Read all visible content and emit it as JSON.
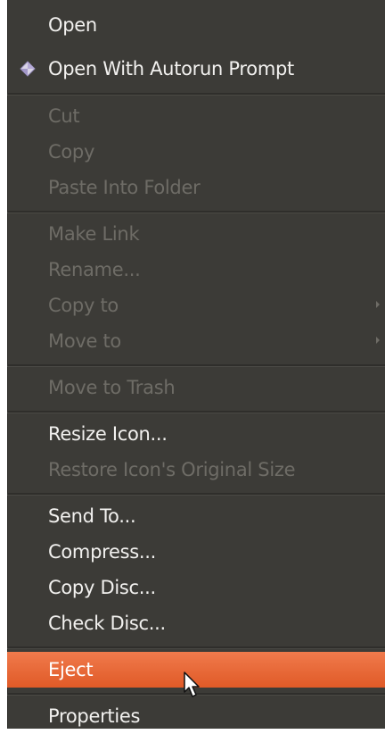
{
  "menu": {
    "items": [
      {
        "label": "Open",
        "enabled": true
      },
      {
        "label": "Open With Autorun Prompt",
        "enabled": true,
        "icon": "autorun-diamond-icon"
      },
      {
        "label": "Cut",
        "enabled": false
      },
      {
        "label": "Copy",
        "enabled": false
      },
      {
        "label": "Paste Into Folder",
        "enabled": false
      },
      {
        "label": "Make Link",
        "enabled": false
      },
      {
        "label": "Rename...",
        "enabled": false
      },
      {
        "label": "Copy to",
        "enabled": false,
        "submenu": true
      },
      {
        "label": "Move to",
        "enabled": false,
        "submenu": true
      },
      {
        "label": "Move to Trash",
        "enabled": false
      },
      {
        "label": "Resize Icon...",
        "enabled": true
      },
      {
        "label": "Restore Icon's Original Size",
        "enabled": false
      },
      {
        "label": "Send To...",
        "enabled": true
      },
      {
        "label": "Compress...",
        "enabled": true
      },
      {
        "label": "Copy Disc...",
        "enabled": true
      },
      {
        "label": "Check Disc...",
        "enabled": true
      },
      {
        "label": "Eject",
        "enabled": true,
        "highlighted": true
      },
      {
        "label": "Properties",
        "enabled": true
      }
    ]
  },
  "colors": {
    "menu_background": "#3c3b37",
    "text_enabled": "#f2f1ef",
    "text_disabled": "#6e6c66",
    "highlight": "#e9642f"
  }
}
